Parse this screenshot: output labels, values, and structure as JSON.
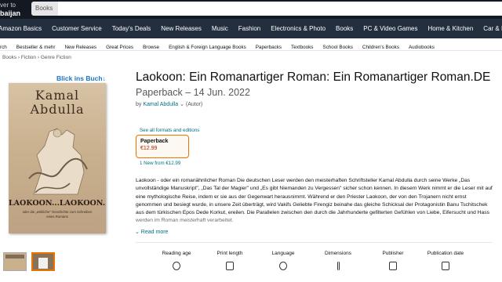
{
  "header": {
    "deliver_line1": "ver to",
    "deliver_line2": "baijan",
    "search_category": "Books"
  },
  "nav": {
    "items": [
      "Amazon Basics",
      "Customer Service",
      "Today's Deals",
      "New Releases",
      "Music",
      "Fashion",
      "Electronics & Photo",
      "Books",
      "PC & Video Games",
      "Home & Kitchen",
      "Car & Motorbike"
    ]
  },
  "subnav": {
    "items": [
      "rch",
      "Bestseller & mehr",
      "New Releases",
      "Great Prices",
      "Browse",
      "English & Foreign Language Books",
      "Paperbacks",
      "Textbooks",
      "School Books",
      "Children's Books",
      "Audiobooks"
    ]
  },
  "breadcrumb": {
    "items": [
      "Books",
      "Fiction",
      "Genre Fiction"
    ],
    "separator": "›"
  },
  "cover": {
    "look_inside_a": "Blick ",
    "look_inside_b": "ins Buch",
    "look_inside_arrow": "↓",
    "author_first": "Kamal",
    "author_last": "Abdulla",
    "title": "LAOKOON...LAOKOON...",
    "subtitle": "oder die „wirkliche\" Geschichte zum Schreiben eines Romans"
  },
  "product": {
    "title": "Laokoon: Ein Romanartiger Roman: Ein Romanartiger Roman.DE",
    "format_date": "Paperback – 14 Jun. 2022",
    "by": "by ",
    "author": "Kamal Abdulla",
    "author_role": " ⌄ (Autor)",
    "see_all": "See all formats and editions",
    "format_name": "Paperback",
    "format_price": "€12.99",
    "new_from": "1 New from €12.99",
    "description": "Laokoon - oder ein romanähnlicher Roman Die deutschen Leser werden den meisterhaften Schriftsteller Kamal Abdulla durch seine Werke „Das unvollständige Manuskript\", „Das Tal der Magier\" und „Es gibt Niemanden zu Vergessen\" sicher schon kennen. In diesem Werk nimmt er die Leser mit auf eine mythologische Reise, indem er sie aus der Gegenwart herausnimmt. Während er den Priester Laokoon, der von den Trojanern nicht ernst genommen und besiegt wurde, in unsere Zeit überträgt, wird Vakifs Geliebte Firengiz beinahe das gleiche Schicksal der Protagonistin Banu Tschitschek aus dem türkischen Epos Dede Korkut, ereilen. Die Parallelen zwischen den durch die Jahrhunderte gefilterten Gefühlen von Liebe, Eifersucht und Hass werden im Roman meisterhaft verarbeitet.",
    "read_more": "⌄ Read more"
  },
  "attributes": {
    "items": [
      "Reading age",
      "Print length",
      "Language",
      "Dimensions",
      "Publisher",
      "Publication date"
    ]
  }
}
